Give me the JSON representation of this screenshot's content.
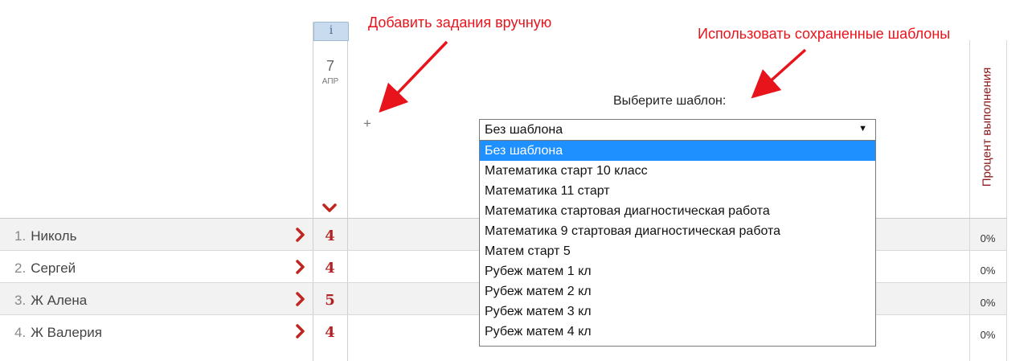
{
  "header": {
    "info_button": "i",
    "date_day": "7",
    "date_month": "АПР",
    "add_task_symbol": "+",
    "percent_column_label": "Процент выполнения"
  },
  "annotations": {
    "add_manual": "Добавить задания вручную",
    "use_templates": "Использовать сохраненные шаблоны"
  },
  "template_select": {
    "label": "Выберите шаблон:",
    "current_value": "Без шаблона",
    "arrow": "▼",
    "options": [
      "Без шаблона",
      "Математика старт 10 класс",
      "Математика 11 старт",
      "Математика стартовая диагностическая работа",
      "Математика 9 стартовая диагностическая работа",
      "Матем старт 5",
      "Рубеж матем 1 кл",
      "Рубеж матем 2 кл",
      "Рубеж матем 3 кл",
      "Рубеж матем 4 кл"
    ],
    "selected_index": 0
  },
  "students": [
    {
      "num": "1.",
      "name": "Николь",
      "grade": "4",
      "percent": "0%"
    },
    {
      "num": "2.",
      "name": "Сергей",
      "grade": "4",
      "percent": "0%"
    },
    {
      "num": "3.",
      "name": "Ж Алена",
      "grade": "5",
      "percent": "0%"
    },
    {
      "num": "4.",
      "name": "Ж Валерия",
      "grade": "4",
      "percent": "0%"
    }
  ],
  "colors": {
    "annotation_red": "#e8141c",
    "grade_red": "#b22222",
    "chevron_red": "#c0261f",
    "selection_blue": "#1e90ff"
  },
  "icons": {
    "row_expand": "chevron-right-icon",
    "column_collapse": "chevron-down-icon"
  }
}
